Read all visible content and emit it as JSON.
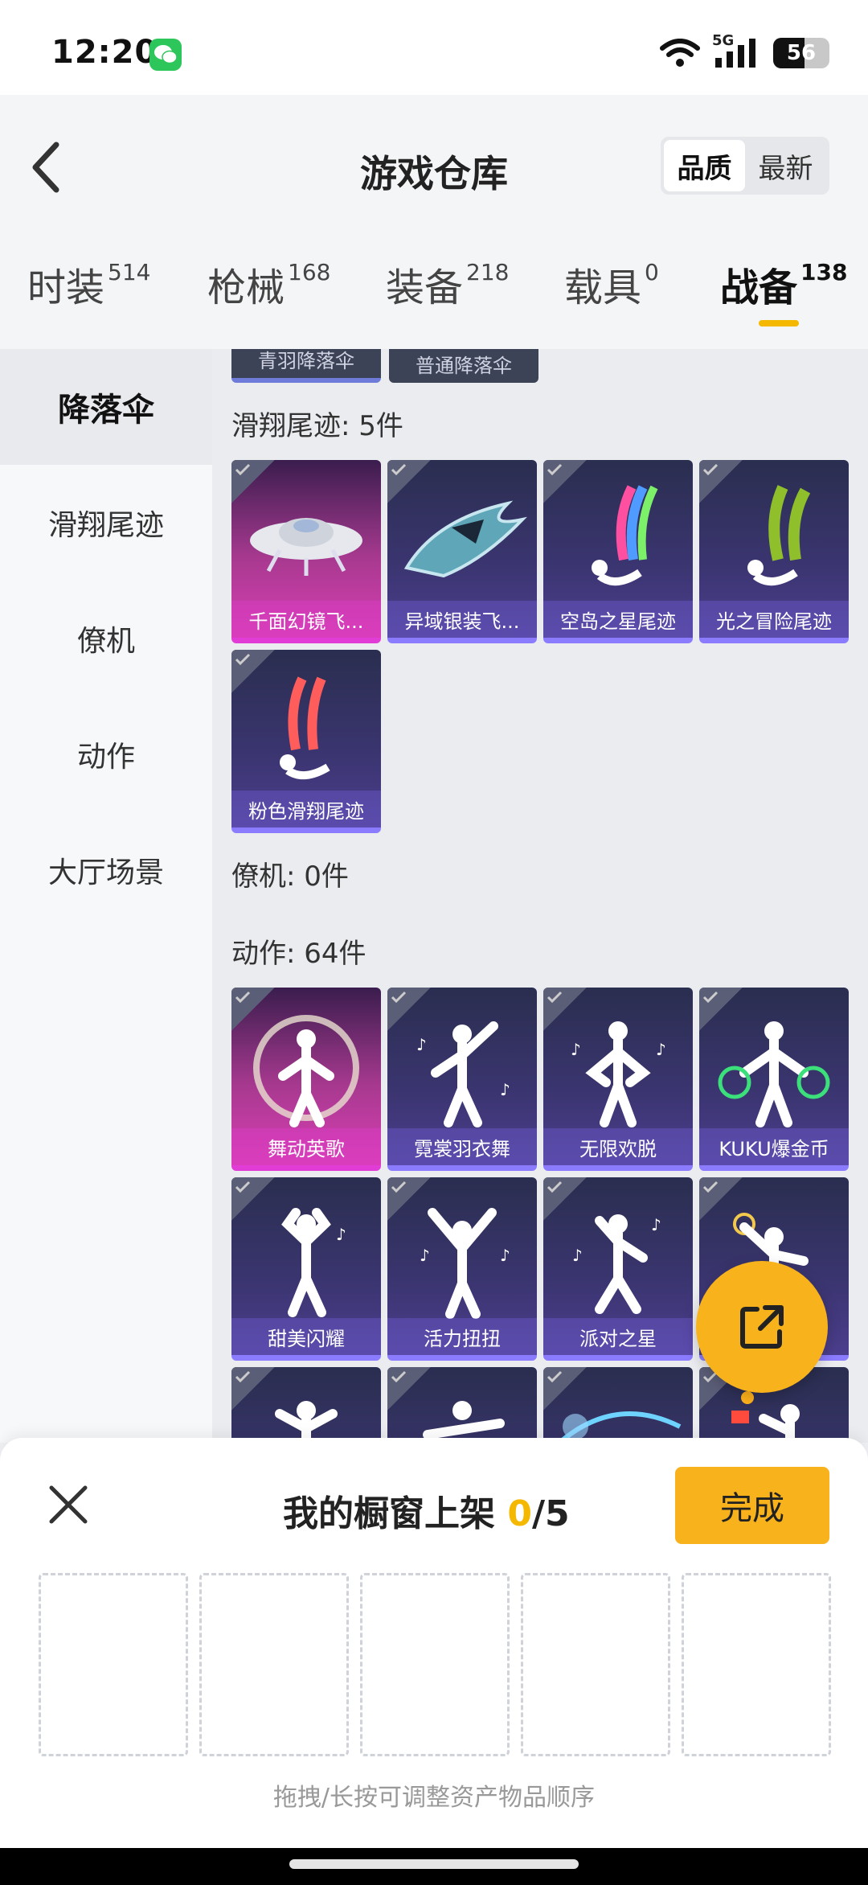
{
  "status": {
    "time": "12:20",
    "network": "5G",
    "battery": "56"
  },
  "header": {
    "title": "游戏仓库",
    "sort_options": [
      "品质",
      "最新"
    ]
  },
  "tabs": [
    {
      "label": "时装",
      "count": "514"
    },
    {
      "label": "枪械",
      "count": "168"
    },
    {
      "label": "装备",
      "count": "218"
    },
    {
      "label": "载具",
      "count": "0"
    },
    {
      "label": "战备",
      "count": "138"
    }
  ],
  "sidebar": [
    "降落伞",
    "滑翔尾迹",
    "僚机",
    "动作",
    "大厅场景"
  ],
  "content": {
    "chips": [
      "青羽降落伞",
      "普通降落伞"
    ],
    "sections": {
      "trail_title": "滑翔尾迹: 5件",
      "wingman_title": "僚机: 0件",
      "action_title": "动作: 64件"
    },
    "trail_items": [
      "千面幻镜飞...",
      "异域银装飞...",
      "空岛之星尾迹",
      "光之冒险尾迹",
      "粉色滑翔尾迹"
    ],
    "action_items": [
      "舞动英歌",
      "霓裳羽衣舞",
      "无限欢脱",
      "KUKU爆金币",
      "甜美闪耀",
      "活力扭扭",
      "派对之星"
    ]
  },
  "sheet": {
    "title_prefix": "我的橱窗上架 ",
    "current": "0",
    "total": "/5",
    "done": "完成",
    "hint": "拖拽/长按可调整资产物品顺序"
  },
  "colors": {
    "accent": "#f7b21c",
    "tab_underline": "#f5b800",
    "card_pink": "#d93fb4",
    "card_purple": "#4c3e8e"
  }
}
